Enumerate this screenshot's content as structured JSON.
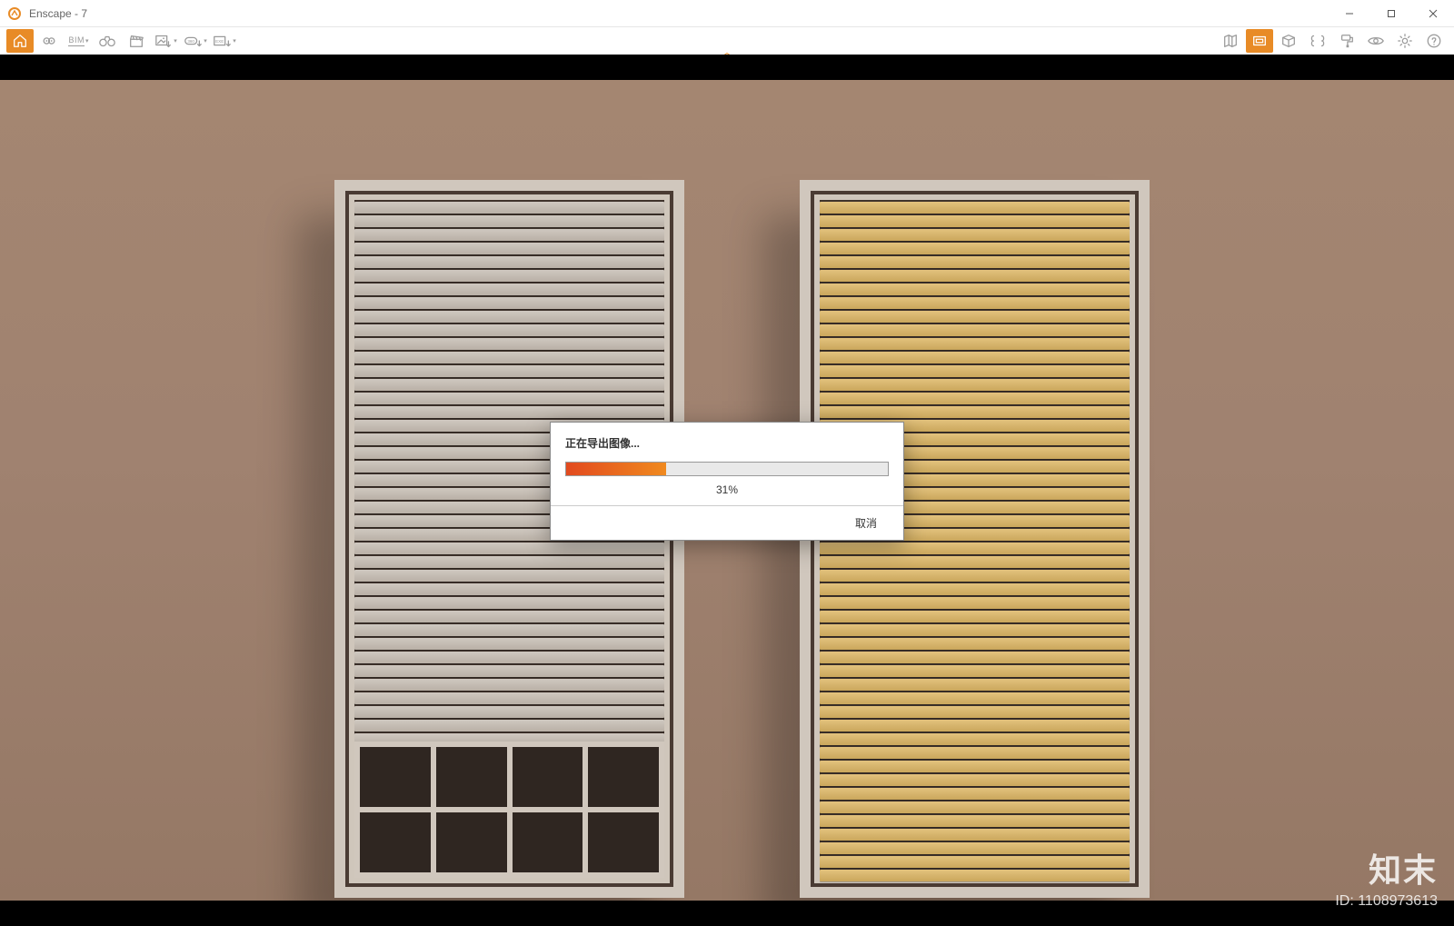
{
  "window": {
    "title": "Enscape - 7"
  },
  "toolbar": {
    "left_groups": [
      {
        "name": "home-button",
        "icon": "home",
        "active": true
      },
      {
        "name": "favorites-button",
        "icon": "pin"
      },
      {
        "name": "bim-button",
        "icon": "bim-text",
        "label": "BIM",
        "dropdown": true
      },
      {
        "name": "binoculars-button",
        "icon": "binoculars"
      },
      {
        "name": "video-button",
        "icon": "clapper"
      },
      {
        "name": "screenshot-button",
        "icon": "image-export",
        "dropdown": true
      },
      {
        "name": "panorama-button",
        "icon": "pano-export",
        "dropdown": true
      },
      {
        "name": "exe-export-button",
        "icon": "exe-export",
        "dropdown": true
      }
    ],
    "right_groups": [
      {
        "name": "map-button",
        "icon": "map"
      },
      {
        "name": "safe-frame-button",
        "icon": "safe-frame",
        "active": true
      },
      {
        "name": "box-button",
        "icon": "box"
      },
      {
        "name": "compare-button",
        "icon": "compare"
      },
      {
        "name": "paint-button",
        "icon": "paint"
      },
      {
        "name": "visibility-button",
        "icon": "eye"
      },
      {
        "name": "settings-button",
        "icon": "gear"
      },
      {
        "name": "help-button",
        "icon": "help"
      }
    ]
  },
  "dialog": {
    "title": "正在导出图像...",
    "percent_value": 31,
    "percent_label": "31%",
    "cancel_label": "取消"
  },
  "watermark": {
    "brand": "知末",
    "id_label": "ID: 1108973613"
  },
  "colors": {
    "accent": "#e88b26",
    "progress_start": "#e24a1f",
    "progress_end": "#f08a1f"
  }
}
